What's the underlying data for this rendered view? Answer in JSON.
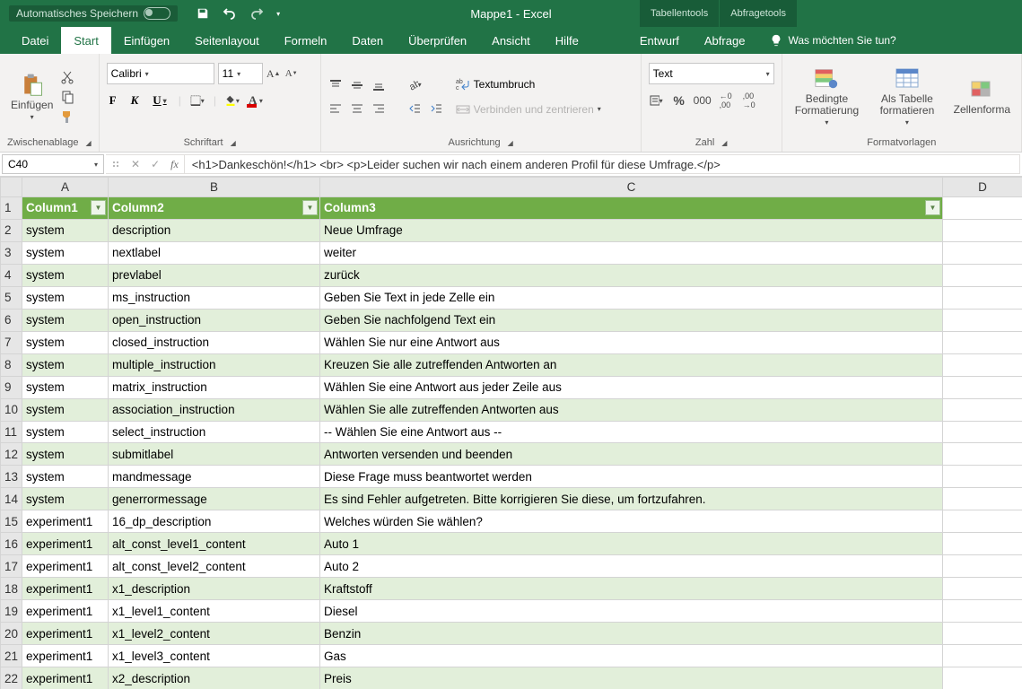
{
  "title": "Mappe1 - Excel",
  "autosave_label": "Automatisches Speichern",
  "context_tools": [
    "Tabellentools",
    "Abfragetools"
  ],
  "tabs": {
    "file": "Datei",
    "home": "Start",
    "insert": "Einfügen",
    "pagelayout": "Seitenlayout",
    "formulas": "Formeln",
    "data": "Daten",
    "review": "Überprüfen",
    "view": "Ansicht",
    "help": "Hilfe",
    "design": "Entwurf",
    "query": "Abfrage"
  },
  "tellme_placeholder": "Was möchten Sie tun?",
  "ribbon": {
    "clipboard_label": "Zwischenablage",
    "paste_label": "Einfügen",
    "font_label": "Schriftart",
    "alignment_label": "Ausrichtung",
    "wrap_label": "Textumbruch",
    "merge_label": "Verbinden und zentrieren",
    "number_label": "Zahl",
    "number_format": "Text",
    "styles_label": "Formatvorlagen",
    "condfmt": "Bedingte Formatierung",
    "as_table": "Als Tabelle formatieren",
    "cellfmt": "Zellenforma",
    "font_name": "Calibri",
    "font_size": "11"
  },
  "namebox": "C40",
  "formula": "<h1>Dankeschön!</h1> <br> <p>Leider suchen wir nach einem anderen Profil für diese Umfrage.</p>",
  "columns": [
    "A",
    "B",
    "C",
    "D"
  ],
  "headers": {
    "c1": "Column1",
    "c2": "Column2",
    "c3": "Column3"
  },
  "rows": [
    {
      "n": 2,
      "a": "system",
      "b": "description",
      "c": "Neue Umfrage"
    },
    {
      "n": 3,
      "a": "system",
      "b": "nextlabel",
      "c": "weiter"
    },
    {
      "n": 4,
      "a": "system",
      "b": "prevlabel",
      "c": "zurück"
    },
    {
      "n": 5,
      "a": "system",
      "b": "ms_instruction",
      "c": "Geben Sie Text in jede Zelle ein"
    },
    {
      "n": 6,
      "a": "system",
      "b": "open_instruction",
      "c": "Geben Sie nachfolgend Text ein"
    },
    {
      "n": 7,
      "a": "system",
      "b": "closed_instruction",
      "c": "Wählen Sie nur eine Antwort aus"
    },
    {
      "n": 8,
      "a": "system",
      "b": "multiple_instruction",
      "c": "Kreuzen Sie alle zutreffenden Antworten an"
    },
    {
      "n": 9,
      "a": "system",
      "b": "matrix_instruction",
      "c": "Wählen Sie eine Antwort aus jeder Zeile aus"
    },
    {
      "n": 10,
      "a": "system",
      "b": "association_instruction",
      "c": "Wählen Sie alle zutreffenden Antworten aus"
    },
    {
      "n": 11,
      "a": "system",
      "b": "select_instruction",
      "c": "-- Wählen Sie eine Antwort aus --"
    },
    {
      "n": 12,
      "a": "system",
      "b": "submitlabel",
      "c": "Antworten versenden und beenden"
    },
    {
      "n": 13,
      "a": "system",
      "b": "mandmessage",
      "c": "Diese Frage muss beantwortet werden"
    },
    {
      "n": 14,
      "a": "system",
      "b": "generrormessage",
      "c": "Es sind Fehler aufgetreten. Bitte korrigieren Sie diese, um fortzufahren."
    },
    {
      "n": 15,
      "a": "experiment1",
      "b": "16_dp_description",
      "c": "Welches würden Sie wählen?"
    },
    {
      "n": 16,
      "a": "experiment1",
      "b": "alt_const_level1_content",
      "c": "Auto 1"
    },
    {
      "n": 17,
      "a": "experiment1",
      "b": "alt_const_level2_content",
      "c": "Auto 2"
    },
    {
      "n": 18,
      "a": "experiment1",
      "b": "x1_description",
      "c": "Kraftstoff"
    },
    {
      "n": 19,
      "a": "experiment1",
      "b": "x1_level1_content",
      "c": "Diesel"
    },
    {
      "n": 20,
      "a": "experiment1",
      "b": "x1_level2_content",
      "c": "Benzin"
    },
    {
      "n": 21,
      "a": "experiment1",
      "b": "x1_level3_content",
      "c": "Gas"
    },
    {
      "n": 22,
      "a": "experiment1",
      "b": "x2_description",
      "c": "Preis"
    }
  ]
}
